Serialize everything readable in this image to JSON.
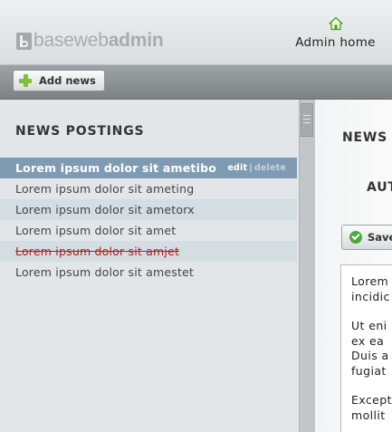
{
  "header": {
    "logo": {
      "text_light_1": "base",
      "text_light_2": "web",
      "text_bold": "admin"
    },
    "home_link": {
      "label": "Admin home",
      "icon": "home-icon"
    }
  },
  "toolbar": {
    "add_news": {
      "label": "Add news",
      "icon": "plus-icon"
    }
  },
  "news": {
    "title": "NEWS POSTINGS",
    "items": [
      {
        "title": "Lorem ipsum dolor sit ametibo",
        "selected": true,
        "deleted": false,
        "edit_label": "edit",
        "separator": "|",
        "delete_label": "delete"
      },
      {
        "title": "Lorem ipsum dolor sit ameting",
        "selected": false,
        "deleted": false
      },
      {
        "title": "Lorem ipsum dolor sit ametorx",
        "selected": false,
        "deleted": false
      },
      {
        "title": "Lorem ipsum dolor sit amet",
        "selected": false,
        "deleted": false
      },
      {
        "title": "Lorem ipsum dolor sit amjet",
        "selected": false,
        "deleted": true
      },
      {
        "title": "Lorem ipsum dolor sit amestet",
        "selected": false,
        "deleted": false
      }
    ]
  },
  "editor": {
    "title": "NEWS T",
    "author_label": "AUT",
    "save_label": "Save",
    "body_lines": [
      [
        "Lorem",
        "incidic"
      ],
      [
        "Ut eni",
        "ex ea",
        "Duis a",
        "fugiat"
      ],
      [
        "Except",
        "mollit"
      ]
    ]
  },
  "colors": {
    "selected_row": "#7f9bb3",
    "alt_row": "#d3dde2",
    "deleted_text": "#b31c1c",
    "add_icon": "#7fbf3a",
    "save_icon": "#4caa3c"
  }
}
